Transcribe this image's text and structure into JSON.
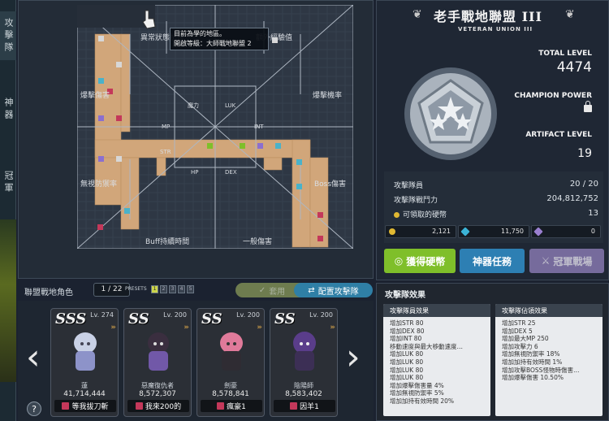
{
  "side_tabs": [
    "攻擊隊",
    "神器",
    "冠軍"
  ],
  "board": {
    "tooltip": [
      "目前為學的地區。",
      "開啟等級：大師戰地聯盟 2"
    ],
    "region_labels": [
      "異常狀態抗性",
      "額外經驗值",
      "爆擊傷害",
      "爆擊機率",
      "無視防禦率",
      "Boss傷害",
      "Buff持續時間",
      "一般傷害"
    ],
    "stat_labels": [
      "魔力",
      "LUK",
      "MP",
      "INT",
      "STR",
      "HP",
      "DEX"
    ]
  },
  "characters": {
    "title": "聯盟戰地角色",
    "page": "1 / 22",
    "presets_label": "PRESETS",
    "presets": [
      "1",
      "2",
      "3",
      "4",
      "5"
    ],
    "apply_label": "套用",
    "assign_label": "配置攻擊隊",
    "cards": [
      {
        "rank": "SSS",
        "level": "Lv. 274",
        "name": "蓮",
        "power": "41,714,444",
        "sub": "等我拔刀斬"
      },
      {
        "rank": "SS",
        "level": "Lv. 200",
        "name": "惡魔復仇者",
        "power": "8,572,307",
        "sub": "我來200的"
      },
      {
        "rank": "SS",
        "level": "Lv. 200",
        "name": "劍豪",
        "power": "8,578,841",
        "sub": "瘋豪1"
      },
      {
        "rank": "SS",
        "level": "Lv. 200",
        "name": "陰陽師",
        "power": "8,583,402",
        "sub": "因羊1"
      }
    ]
  },
  "union": {
    "title": "老手戰地聯盟 III",
    "subtitle": "VETERAN UNION III",
    "total_level_label": "TOTAL LEVEL",
    "total_level": "4474",
    "champion_power_label": "CHAMPION POWER",
    "artifact_level_label": "ARTIFACT LEVEL",
    "artifact_level": "19",
    "members_label": "攻擊隊員",
    "members": "20 / 20",
    "power_label": "攻擊隊戰鬥力",
    "power": "204,812,752",
    "coins_label": "可領取的硬幣",
    "coins": "13",
    "currency": [
      "2,121",
      "11,750",
      "0"
    ],
    "btn_coins": "獲得硬幣",
    "btn_artifact": "神器任務",
    "btn_champion": "冠軍戰場"
  },
  "effects": {
    "title": "攻擊隊效果",
    "member_title": "攻擊隊員效果",
    "member_effects": [
      "增加STR 80",
      "增加DEX 80",
      "增加INT 80",
      "移動速度與最大移動速度…",
      "增加LUK 80",
      "增加LUK 80",
      "增加LUK 80",
      "增加LUK 80",
      "增加爆擊傷害量 4%",
      "增加無視防禦率 5%",
      "增加加持有效時間 20%"
    ],
    "grid_title": "攻擊隊佔領效果",
    "grid_effects": [
      "增加STR 25",
      "增加DEX 5",
      "增加最大MP 250",
      "增加攻擊力 6",
      "增加無視防禦率 18%",
      "增加加持有效時間 1%",
      "增加攻擊BOSS怪物時傷害…",
      "增加爆擊傷害 10.50%"
    ]
  },
  "colors": {
    "accent_green": "#7fbf2a",
    "accent_blue": "#2d7fb3",
    "accent_purple": "#8c7cb7",
    "board_fill": "#d3a97c",
    "rank_purple": "#c4385a"
  }
}
